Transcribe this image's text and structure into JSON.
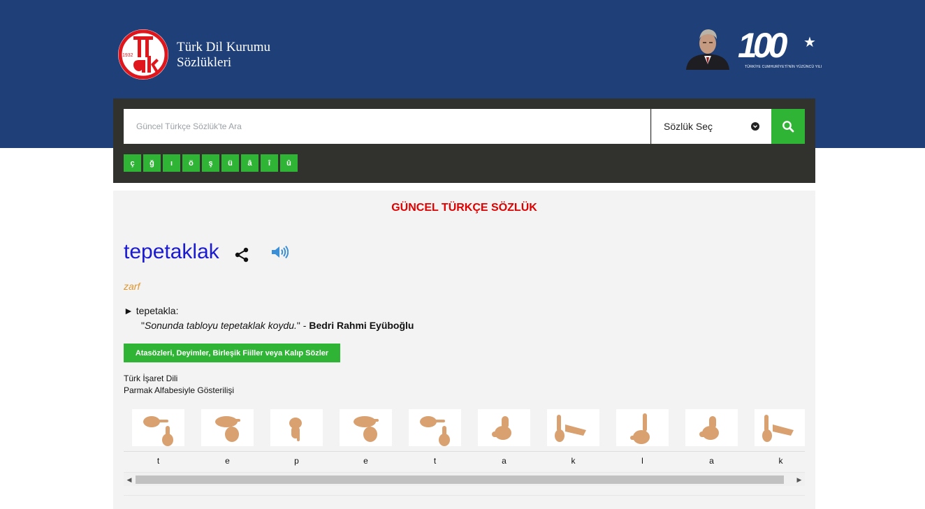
{
  "header": {
    "brand_line1": "Türk Dil Kurumu",
    "brand_line2": "Sözlükleri",
    "logo_year": "1932",
    "centennial_number": "100",
    "centennial_caption": "TÜRKİYE CUMHURİYETİ'NİN YÜZÜNCÜ YILI",
    "colors": {
      "band": "#1e3f78",
      "logo_red": "#e0161d"
    }
  },
  "search": {
    "placeholder": "Güncel Türkçe Sözlük'te Ara",
    "value": "",
    "dictionary_select": "Sözlük Seç",
    "search_icon": "search-icon",
    "special_letters": [
      "ç",
      "ğ",
      "ı",
      "ö",
      "ş",
      "ü",
      "â",
      "î",
      "û"
    ],
    "colors": {
      "panel": "#31322e",
      "accent": "#2fb436"
    }
  },
  "result": {
    "dictionary_title": "GÜNCEL TÜRKÇE SÖZLÜK",
    "headword": "tepetaklak",
    "part_of_speech": "zarf",
    "definition_marker": "►",
    "definition": "tepetakla:",
    "example_quote_open": "\"",
    "example": "Sonunda tabloyu tepetaklak koydu.",
    "example_quote_close": "\" - ",
    "example_author": "Bedri Rahmi Eyüboğlu",
    "idioms_button": "Atasözleri, Deyimler, Birleşik Fiiller veya Kalıp Sözler",
    "sign_language_line1": "Türk İşaret Dili",
    "sign_language_line2": "Parmak Alfabesiyle Gösterilişi",
    "fingerspelling": [
      "t",
      "e",
      "p",
      "e",
      "t",
      "a",
      "k",
      "l",
      "a",
      "k"
    ],
    "colors": {
      "headword": "#1a1ad0",
      "pos": "#e0962a",
      "title": "#e00000",
      "skin": "#d9a070"
    }
  }
}
